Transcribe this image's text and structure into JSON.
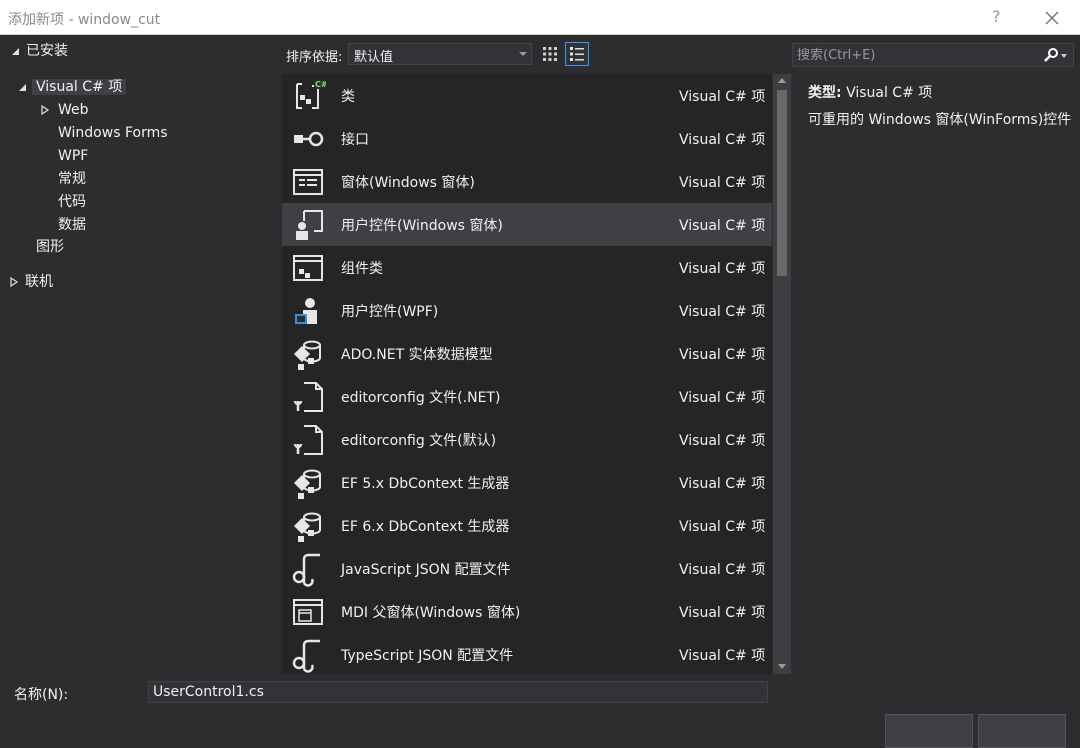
{
  "window": {
    "title": "添加新项 - window_cut",
    "help_label": "?"
  },
  "tree": {
    "installed": "已安装",
    "visual_csharp": "Visual C# 项",
    "web": "Web",
    "windows_forms": "Windows Forms",
    "wpf": "WPF",
    "general": "常规",
    "code": "代码",
    "data": "数据",
    "graphics": "图形",
    "online": "联机"
  },
  "sort": {
    "label": "排序依据:",
    "value": "默认值"
  },
  "search": {
    "placeholder": "搜索(Ctrl+E)"
  },
  "templates": [
    {
      "name": "类",
      "type": "Visual C# 项",
      "icon": "class-icon"
    },
    {
      "name": "接口",
      "type": "Visual C# 项",
      "icon": "interface-icon"
    },
    {
      "name": "窗体(Windows 窗体)",
      "type": "Visual C# 项",
      "icon": "form-icon"
    },
    {
      "name": "用户控件(Windows 窗体)",
      "type": "Visual C# 项",
      "icon": "user-control-icon"
    },
    {
      "name": "组件类",
      "type": "Visual C# 项",
      "icon": "component-icon"
    },
    {
      "name": "用户控件(WPF)",
      "type": "Visual C# 项",
      "icon": "wpf-user-control-icon"
    },
    {
      "name": "ADO.NET 实体数据模型",
      "type": "Visual C# 项",
      "icon": "entity-model-icon"
    },
    {
      "name": "editorconfig 文件(.NET)",
      "type": "Visual C# 项",
      "icon": "config-file-icon"
    },
    {
      "name": "editorconfig 文件(默认)",
      "type": "Visual C# 项",
      "icon": "config-file-icon"
    },
    {
      "name": "EF 5.x DbContext 生成器",
      "type": "Visual C# 项",
      "icon": "entity-model-icon"
    },
    {
      "name": "EF 6.x DbContext 生成器",
      "type": "Visual C# 项",
      "icon": "entity-model-icon"
    },
    {
      "name": "JavaScript JSON 配置文件",
      "type": "Visual C# 项",
      "icon": "json-file-icon"
    },
    {
      "name": "MDI 父窗体(Windows 窗体)",
      "type": "Visual C# 项",
      "icon": "mdi-form-icon"
    },
    {
      "name": "TypeScript JSON 配置文件",
      "type": "Visual C# 项",
      "icon": "json-file-icon"
    }
  ],
  "selected_index": 3,
  "details": {
    "type_label": "类型:",
    "type_value": "Visual C# 项",
    "description": "可重用的 Windows 窗体(WinForms)控件"
  },
  "name_field": {
    "label": "名称(N):",
    "value": "UserControl1.cs"
  },
  "colors": {
    "background": "#2d2d30",
    "list_background": "#252526",
    "selection": "#3f3f46",
    "accent": "#3399ff"
  }
}
